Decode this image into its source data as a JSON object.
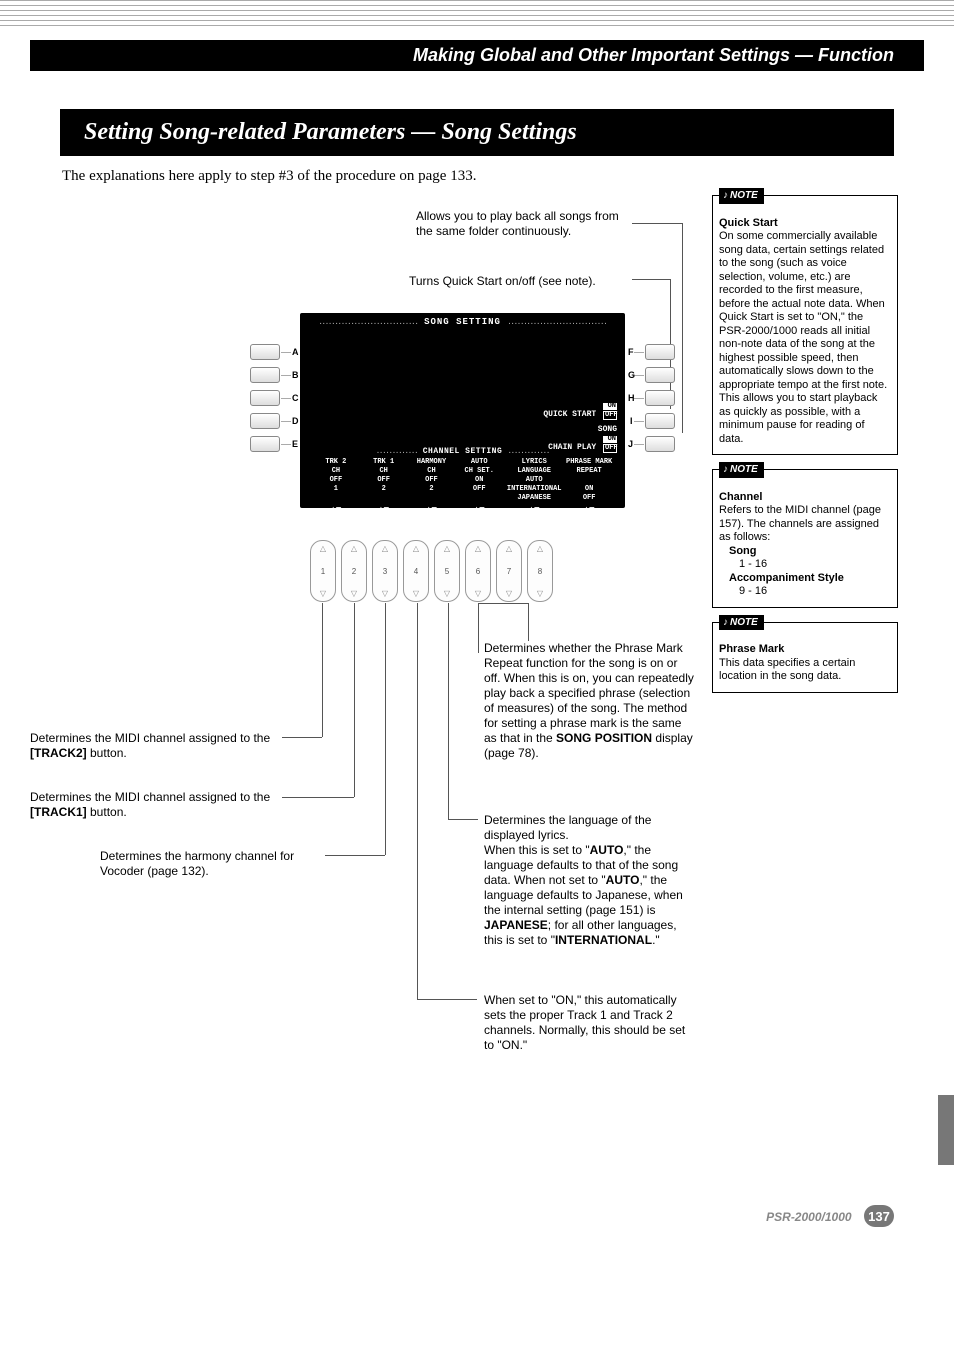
{
  "header": {
    "breadcrumb": "Making Global and Other Important Settings — Function"
  },
  "title": "Setting Song-related Parameters — Song Settings",
  "intro": "The explanations here apply to step #3 of the procedure on page 133.",
  "lcd": {
    "title": "SONG SETTING",
    "quickstart_label": "QUICK START",
    "quickstart_on": "ON",
    "quickstart_off": "OFF",
    "chainplay_label": "SONG\nCHAIN PLAY",
    "chainplay_on": "ON",
    "chainplay_off": "OFF",
    "ch_heading": "CHANNEL SETTING",
    "cols": [
      "TRK 2\nCH\nOFF\n1",
      "TRK 1\nCH\nOFF\n2",
      "HARMONY\nCH\nOFF\n2",
      "AUTO\nCH SET.\nON\nOFF",
      "LYRICS\nLANGUAGE\nAUTO\nINTERNATIONAL\nJAPANESE",
      "PHRASE MARK\nREPEAT\n\nON\nOFF"
    ],
    "toggle_numbers": [
      "1",
      "2",
      "3",
      "4",
      "5",
      "6",
      "7",
      "8"
    ]
  },
  "side_labels_left": [
    "A",
    "B",
    "C",
    "D",
    "E"
  ],
  "side_labels_right": [
    "F",
    "G",
    "H",
    "I",
    "J"
  ],
  "callouts": {
    "c1": "Allows you to play back all songs from the same folder continuously.",
    "c2": "Turns Quick Start on/off (see note).",
    "c3_1": "Determines whether the Phrase Mark Repeat function for the song is on or off. When this is on, you can repeatedly play back a specified phrase (selection of measures) of the song. The method for setting a phrase mark is the same as that in the ",
    "c3_b": "SONG POSITION",
    "c3_2": " display (page 78).",
    "c4": "Determines the MIDI channel assigned to the ",
    "c4b": "[TRACK2]",
    "c4_2": " button.",
    "c5": "Determines the MIDI channel assigned to the ",
    "c5b": "[TRACK1]",
    "c5_2": " button.",
    "c6": "Determines the harmony channel for Vocoder (page 132).",
    "c7_1": "Determines the language of the displayed lyrics.",
    "c7_2a": "When this is set to \"",
    "c7_2b": "AUTO",
    "c7_2c": ",\" the language defaults to that of the song data. When not set to \"",
    "c7_2d": "AUTO",
    "c7_2e": ",\" the language defaults to Japanese, when the internal setting (page 151) is ",
    "c7_2f": "JAPANESE",
    "c7_2g": "; for all other languages, this is set to \"",
    "c7_2h": "INTERNATIONAL",
    "c7_2i": ".\"",
    "c8": "When set to \"ON,\" this automatically sets the proper Track 1 and Track 2 channels. Normally, this should be set to \"ON.\""
  },
  "notes": {
    "label": "NOTE",
    "n1_title": "Quick Start",
    "n1_body": "On some commercially available song data, certain settings related to the song (such as voice selection, volume, etc.) are recorded to the first measure, before the actual note data. When Quick Start is set to \"ON,\" the PSR-2000/1000 reads all initial non-note data of the song at the highest possible speed, then automatically slows down to the appropriate tempo at the first note. This allows you to start playback as quickly as possible, with a minimum pause for reading of data.",
    "n2_title": "Channel",
    "n2_body": "Refers to the MIDI channel (page 157). The channels are assigned as follows:",
    "n2_song": "Song",
    "n2_song_r": "1 - 16",
    "n2_acc": "Accompaniment Style",
    "n2_acc_r": "9 - 16",
    "n3_title": "Phrase Mark",
    "n3_body": "This data specifies a certain location in the song data."
  },
  "footer": {
    "model": "PSR-2000/1000",
    "page": "137"
  }
}
